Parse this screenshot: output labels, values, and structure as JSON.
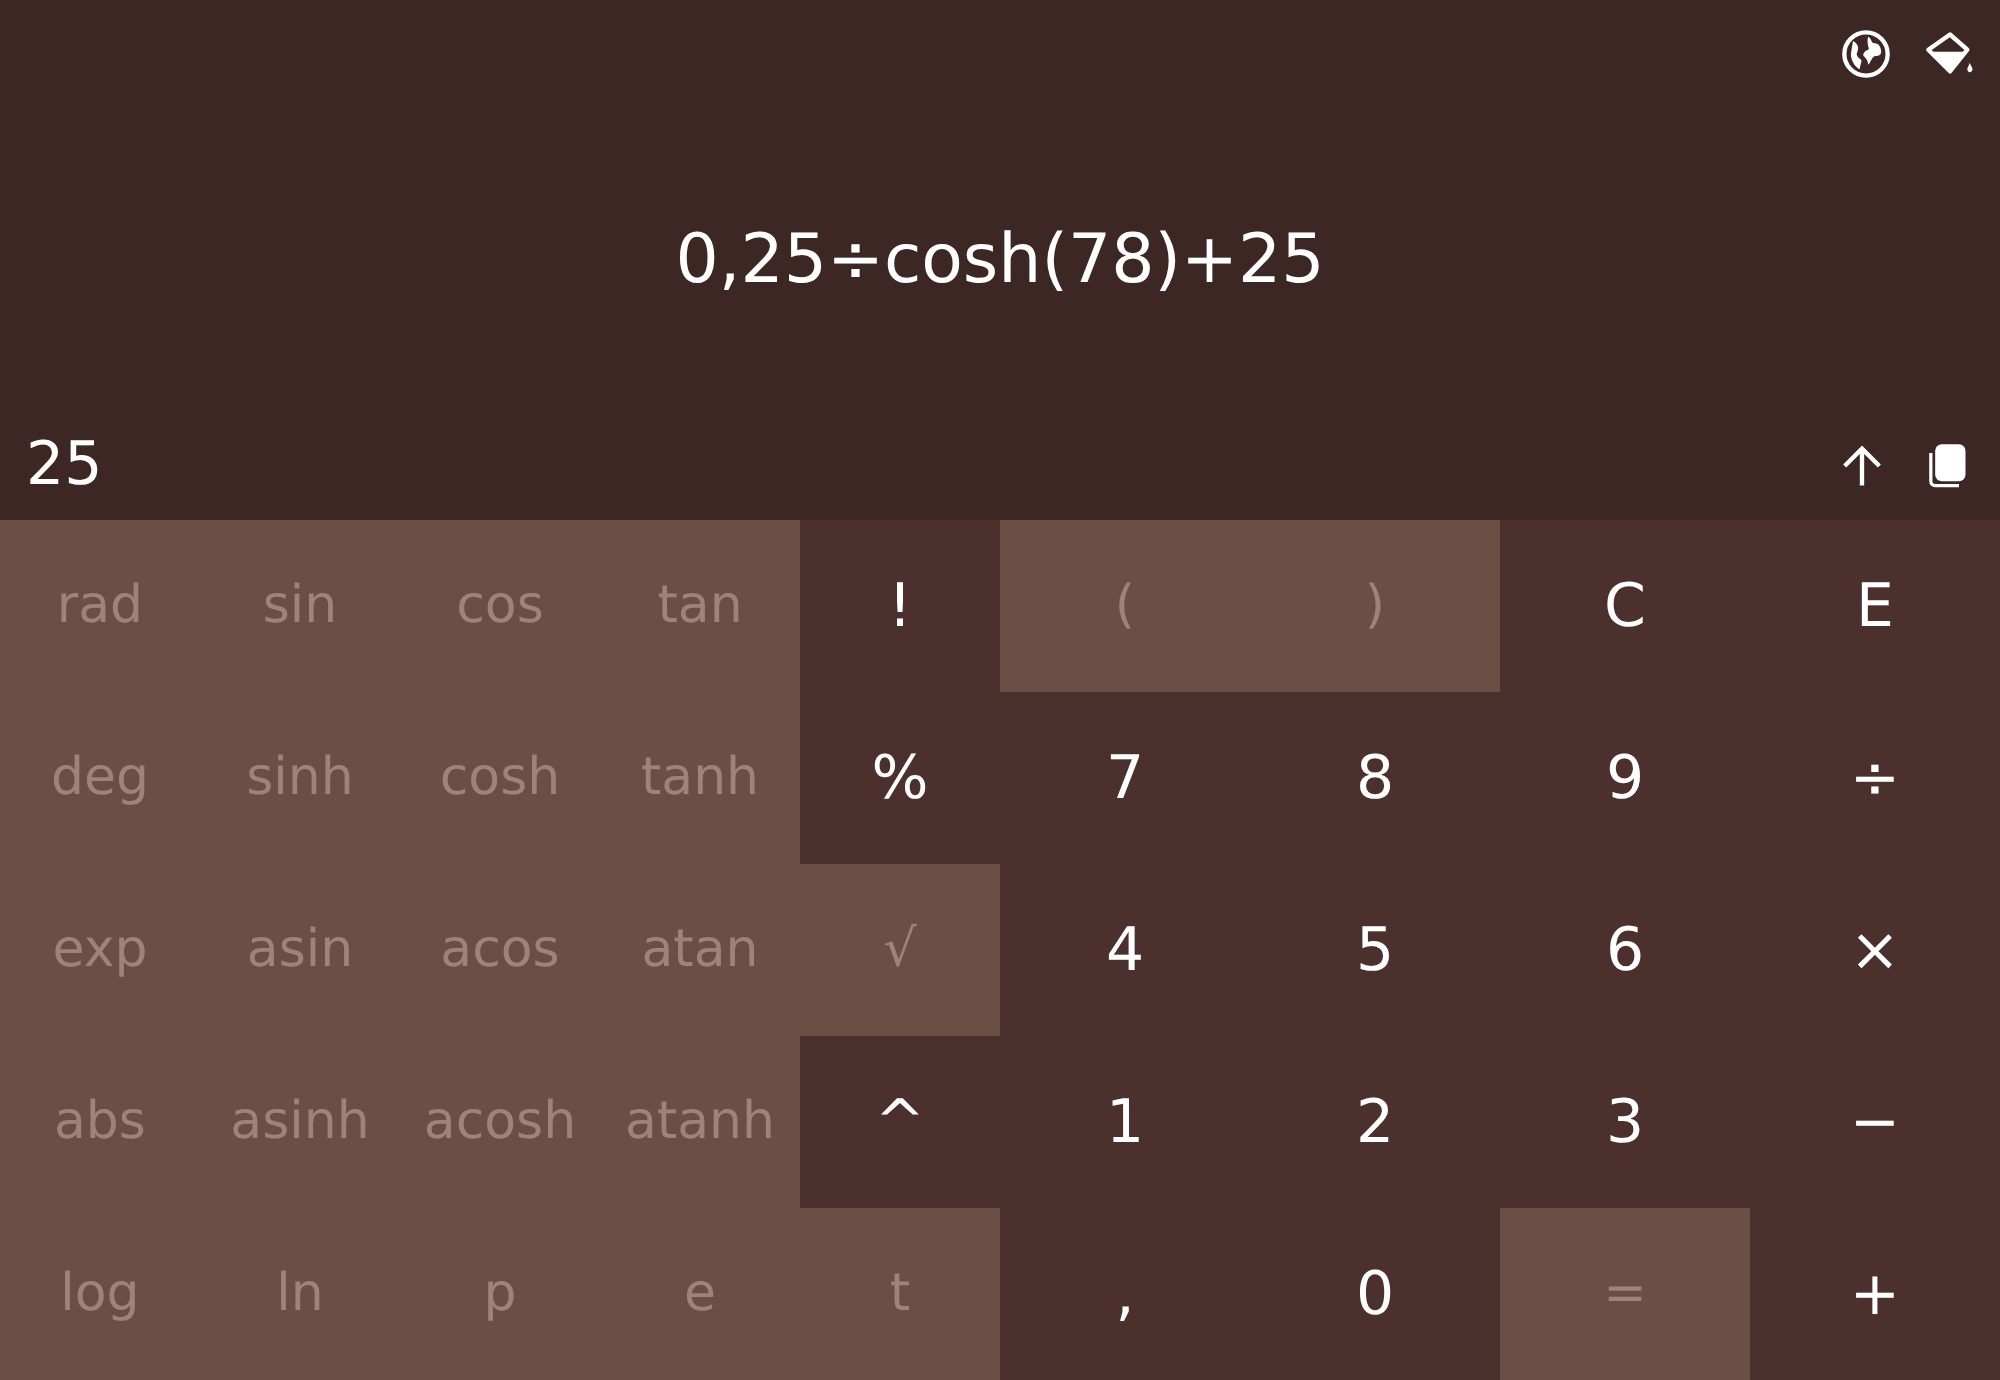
{
  "expression": "0,25÷cosh(78)+25",
  "result": "25",
  "keys": [
    {
      "label": "rad",
      "kind": "function"
    },
    {
      "label": "sin",
      "kind": "function"
    },
    {
      "label": "cos",
      "kind": "function"
    },
    {
      "label": "tan",
      "kind": "function"
    },
    {
      "label": "!",
      "kind": "main"
    },
    {
      "label": "(",
      "kind": "function"
    },
    {
      "label": ")",
      "kind": "function"
    },
    {
      "label": "C",
      "kind": "main"
    },
    {
      "label": "E",
      "kind": "main"
    },
    {
      "label": "deg",
      "kind": "function"
    },
    {
      "label": "sinh",
      "kind": "function"
    },
    {
      "label": "cosh",
      "kind": "function"
    },
    {
      "label": "tanh",
      "kind": "function"
    },
    {
      "label": "%",
      "kind": "main"
    },
    {
      "label": "7",
      "kind": "main"
    },
    {
      "label": "8",
      "kind": "main"
    },
    {
      "label": "9",
      "kind": "main"
    },
    {
      "label": "÷",
      "kind": "main"
    },
    {
      "label": "exp",
      "kind": "function"
    },
    {
      "label": "asin",
      "kind": "function"
    },
    {
      "label": "acos",
      "kind": "function"
    },
    {
      "label": "atan",
      "kind": "function"
    },
    {
      "label": "√",
      "kind": "function"
    },
    {
      "label": "4",
      "kind": "main"
    },
    {
      "label": "5",
      "kind": "main"
    },
    {
      "label": "6",
      "kind": "main"
    },
    {
      "label": "×",
      "kind": "main"
    },
    {
      "label": "abs",
      "kind": "function"
    },
    {
      "label": "asinh",
      "kind": "function"
    },
    {
      "label": "acosh",
      "kind": "function"
    },
    {
      "label": "atanh",
      "kind": "function"
    },
    {
      "label": "^",
      "kind": "main"
    },
    {
      "label": "1",
      "kind": "main"
    },
    {
      "label": "2",
      "kind": "main"
    },
    {
      "label": "3",
      "kind": "main"
    },
    {
      "label": "−",
      "kind": "main"
    },
    {
      "label": "log",
      "kind": "function"
    },
    {
      "label": "ln",
      "kind": "function"
    },
    {
      "label": "p",
      "kind": "function"
    },
    {
      "label": "e",
      "kind": "function"
    },
    {
      "label": "t",
      "kind": "function"
    },
    {
      "label": ",",
      "kind": "main"
    },
    {
      "label": "0",
      "kind": "main"
    },
    {
      "label": "=",
      "kind": "function"
    },
    {
      "label": "+",
      "kind": "main"
    }
  ]
}
